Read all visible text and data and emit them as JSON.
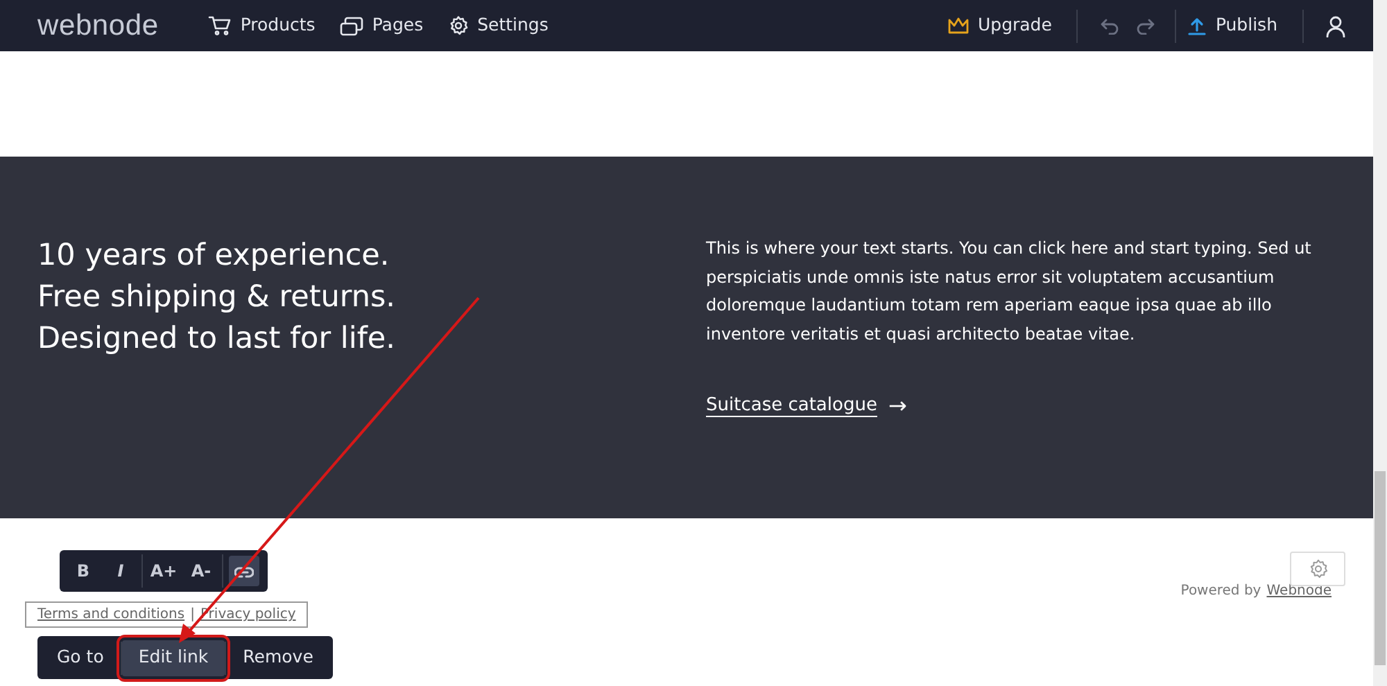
{
  "navbar": {
    "logo": "webnode",
    "nav_items": [
      {
        "label": "Products",
        "kind": "cart"
      },
      {
        "label": "Pages",
        "kind": "pages"
      },
      {
        "label": "Settings",
        "kind": "gear"
      }
    ],
    "upgrade": "Upgrade",
    "publish": "Publish"
  },
  "banner": {
    "headline_lines": [
      "10 years of experience.",
      "Free shipping & returns.",
      "Designed to last for life."
    ],
    "paragraph": "This is where your text starts. You can click here and start typing. Sed ut perspiciatis unde omnis iste natus error sit voluptatem accusantium doloremque laudantium totam rem aperiam eaque ipsa quae ab illo inventore veritatis et quasi architecto beatae vitae.",
    "link": "Suitcase catalogue",
    "link_arrow": "→"
  },
  "footer": {
    "links": [
      "Terms and conditions",
      "Privacy policy"
    ],
    "separator": "|",
    "powered_by": "Powered by",
    "powered_link": "Webnode"
  },
  "format_toolbar": [
    {
      "kind": "bold",
      "label": "B",
      "selected": false
    },
    {
      "kind": "italic",
      "label": "I",
      "selected": false
    },
    {
      "kind": "grow",
      "label": "A+",
      "selected": false
    },
    {
      "kind": "shrink",
      "label": "A-",
      "selected": false
    },
    {
      "kind": "link",
      "selected": true
    }
  ],
  "link_toolbar": [
    {
      "label": "Go to",
      "selected": false
    },
    {
      "label": "Edit link",
      "selected": true
    },
    {
      "label": "Remove",
      "selected": false
    }
  ]
}
